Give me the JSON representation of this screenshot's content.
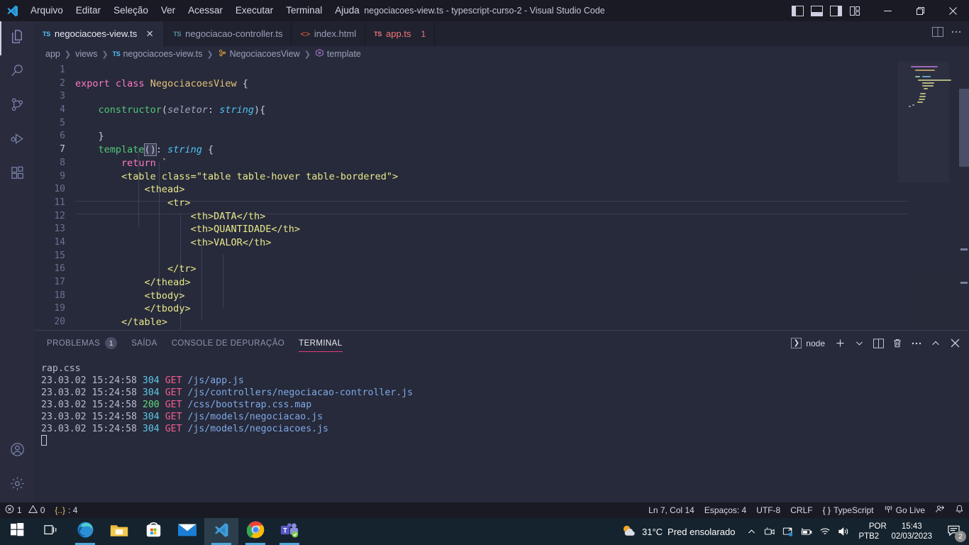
{
  "titlebar": {
    "menus": [
      "Arquivo",
      "Editar",
      "Seleção",
      "Ver",
      "Acessar",
      "Executar",
      "Terminal",
      "Ajuda"
    ],
    "window_title": "negociacoes-view.ts - typescript-curso-2 - Visual Studio Code",
    "layout_icons": [
      "toggle-primary-sidebar-icon",
      "toggle-panel-icon",
      "toggle-secondary-sidebar-icon",
      "customize-layout-icon"
    ],
    "window_controls": [
      "minimize",
      "maximize",
      "close"
    ]
  },
  "activitybar": {
    "items": [
      {
        "name": "explorer",
        "icon": "files-icon",
        "active": true
      },
      {
        "name": "search",
        "icon": "search-icon",
        "active": false
      },
      {
        "name": "source-control",
        "icon": "source-control-icon",
        "active": false
      },
      {
        "name": "run-and-debug",
        "icon": "run-debug-icon",
        "active": false
      },
      {
        "name": "extensions",
        "icon": "extensions-icon",
        "active": false
      }
    ],
    "bottom": [
      {
        "name": "accounts",
        "icon": "account-icon"
      },
      {
        "name": "manage",
        "icon": "gear-icon"
      }
    ]
  },
  "tabs": [
    {
      "label": "negociacoes-view.ts",
      "icon": "ts-icon",
      "active": true,
      "dirty": false,
      "badge": "",
      "closeable": true
    },
    {
      "label": "negociacao-controller.ts",
      "icon": "ts-icon",
      "active": false,
      "badge": ""
    },
    {
      "label": "index.html",
      "icon": "html-icon",
      "active": false,
      "badge": ""
    },
    {
      "label": "app.ts",
      "icon": "ts-icon",
      "active": false,
      "badge": "1",
      "error": true
    }
  ],
  "breadcrumbs": [
    {
      "label": "app",
      "icon": ""
    },
    {
      "label": "views",
      "icon": ""
    },
    {
      "label": "negociacoes-view.ts",
      "icon": "ts-icon"
    },
    {
      "label": "NegociacoesView",
      "icon": "class-icon"
    },
    {
      "label": "template",
      "icon": "method-icon"
    }
  ],
  "editor": {
    "language": "TypeScript",
    "lines": [
      {
        "n": 1,
        "text": ""
      },
      {
        "n": 2,
        "text": "export class NegociacoesView {"
      },
      {
        "n": 3,
        "text": ""
      },
      {
        "n": 4,
        "text": "    constructor(seletor: string){"
      },
      {
        "n": 5,
        "text": ""
      },
      {
        "n": 6,
        "text": "    }"
      },
      {
        "n": 7,
        "text": "    template(): string {"
      },
      {
        "n": 8,
        "text": "        return `"
      },
      {
        "n": 9,
        "text": "        <table class=\"table table-hover table-bordered\">"
      },
      {
        "n": 10,
        "text": "            <thead>"
      },
      {
        "n": 11,
        "text": "                <tr>"
      },
      {
        "n": 12,
        "text": "                    <th>DATA</th>"
      },
      {
        "n": 13,
        "text": "                    <th>QUANTIDADE</th>"
      },
      {
        "n": 14,
        "text": "                    <th>VALOR</th>"
      },
      {
        "n": 15,
        "text": ""
      },
      {
        "n": 16,
        "text": "                </tr>"
      },
      {
        "n": 17,
        "text": "            </thead>"
      },
      {
        "n": 18,
        "text": "            <tbody>"
      },
      {
        "n": 19,
        "text": "            </tbody>"
      },
      {
        "n": 20,
        "text": "        </table>"
      }
    ],
    "current_line": 7
  },
  "panel": {
    "tabs": [
      {
        "label": "PROBLEMAS",
        "badge": "1",
        "active": false
      },
      {
        "label": "SAÍDA",
        "badge": "",
        "active": false
      },
      {
        "label": "CONSOLE DE DEPURAÇÃO",
        "badge": "",
        "active": false
      },
      {
        "label": "TERMINAL",
        "badge": "",
        "active": true
      }
    ],
    "terminal_selector": "node",
    "actions": [
      "new-terminal-icon",
      "terminal-dropdown-icon",
      "split-terminal-icon",
      "kill-terminal-icon",
      "more-actions-icon",
      "maximize-panel-icon",
      "close-panel-icon"
    ],
    "terminal_lines": [
      {
        "segments": [
          {
            "t": "rap.css",
            "c": "t-gray"
          }
        ]
      },
      {
        "segments": [
          {
            "t": "23.03.02 15:24:58 ",
            "c": "t-gray"
          },
          {
            "t": "304",
            "c": "t-cyan"
          },
          {
            "t": " ",
            "c": "t-gray"
          },
          {
            "t": "GET",
            "c": "t-pink"
          },
          {
            "t": " /js/app.js",
            "c": "t-blue"
          }
        ]
      },
      {
        "segments": [
          {
            "t": "23.03.02 15:24:58 ",
            "c": "t-gray"
          },
          {
            "t": "304",
            "c": "t-cyan"
          },
          {
            "t": " ",
            "c": "t-gray"
          },
          {
            "t": "GET",
            "c": "t-pink"
          },
          {
            "t": " /js/controllers/negociacao-controller.js",
            "c": "t-blue"
          }
        ]
      },
      {
        "segments": [
          {
            "t": "23.03.02 15:24:58 ",
            "c": "t-gray"
          },
          {
            "t": "200",
            "c": "t-green"
          },
          {
            "t": " ",
            "c": "t-gray"
          },
          {
            "t": "GET",
            "c": "t-pink"
          },
          {
            "t": " /css/bootstrap.css.map",
            "c": "t-blue"
          }
        ]
      },
      {
        "segments": [
          {
            "t": "23.03.02 15:24:58 ",
            "c": "t-gray"
          },
          {
            "t": "304",
            "c": "t-cyan"
          },
          {
            "t": " ",
            "c": "t-gray"
          },
          {
            "t": "GET",
            "c": "t-pink"
          },
          {
            "t": " /js/models/negociacao.js",
            "c": "t-blue"
          }
        ]
      },
      {
        "segments": [
          {
            "t": "23.03.02 15:24:58 ",
            "c": "t-gray"
          },
          {
            "t": "304",
            "c": "t-cyan"
          },
          {
            "t": " ",
            "c": "t-gray"
          },
          {
            "t": "GET",
            "c": "t-pink"
          },
          {
            "t": " /js/models/negociacoes.js",
            "c": "t-blue"
          }
        ]
      }
    ]
  },
  "statusbar": {
    "errors": "1",
    "warnings": "0",
    "ports": ": 4",
    "cursor": "Ln 7, Col 14",
    "indent": "Espaços: 4",
    "encoding": "UTF-8",
    "eol": "CRLF",
    "language": "TypeScript",
    "golive": "Go Live",
    "icons": [
      "error-icon",
      "warning-icon",
      "ports-icon",
      "braces-icon",
      "broadcast-icon",
      "feedback-icon",
      "bell-icon"
    ]
  },
  "taskbar": {
    "buttons": [
      {
        "name": "start-button",
        "icon": "windows-logo-icon"
      },
      {
        "name": "task-view-button",
        "icon": "task-view-icon"
      },
      {
        "name": "edge-button",
        "icon": "edge-icon"
      },
      {
        "name": "file-explorer-button",
        "icon": "folder-icon"
      },
      {
        "name": "microsoft-store-button",
        "icon": "store-icon"
      },
      {
        "name": "mail-button",
        "icon": "mail-icon"
      },
      {
        "name": "vscode-button",
        "icon": "vscode-icon"
      },
      {
        "name": "chrome-button",
        "icon": "chrome-icon"
      },
      {
        "name": "teams-button",
        "icon": "teams-icon"
      }
    ],
    "weather_temp": "31°C",
    "weather_desc": "Pred ensolarado",
    "tray": [
      "show-hidden-icons",
      "camera-icon",
      "display-icon",
      "battery-icon",
      "wifi-icon",
      "volume-icon"
    ],
    "lang_line1": "POR",
    "lang_line2": "PTB2",
    "time": "15:43",
    "date": "02/03/2023",
    "notification_count": "2"
  },
  "colors": {
    "editor_bg": "#272a3a",
    "titlebar_bg": "#191a23",
    "activitybar_bg": "#2a2c3e",
    "accent_pink": "#e23c78",
    "taskbar_bg": "#15232e",
    "error_red": "#f2777a"
  }
}
